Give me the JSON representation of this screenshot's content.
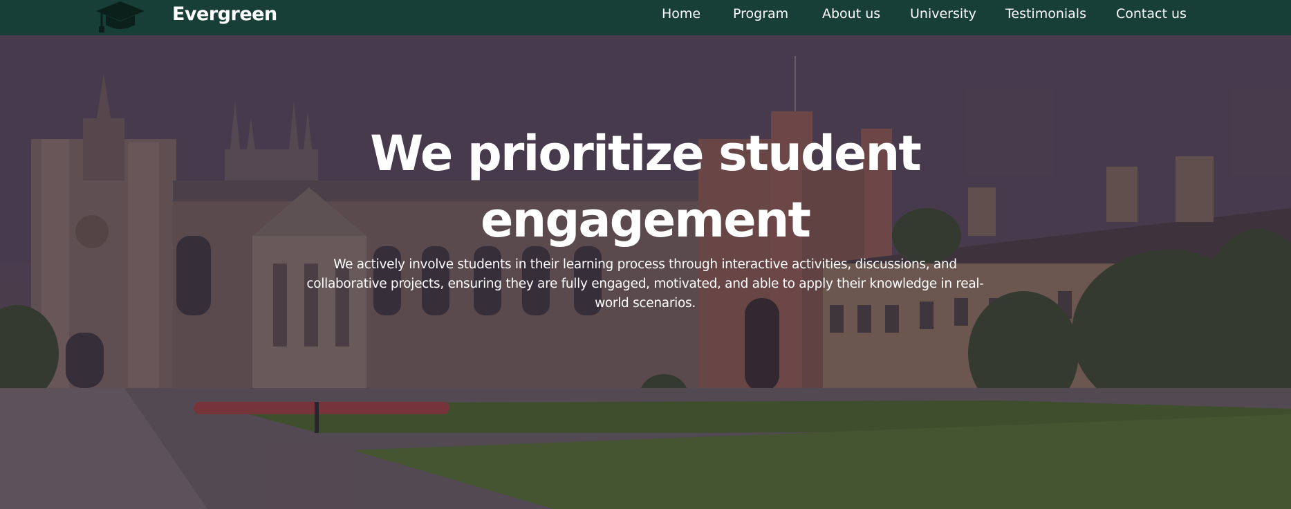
{
  "navbar": {
    "brand": "Evergreen",
    "logo_icon": "graduation-cap-icon",
    "links": [
      {
        "label": "Home"
      },
      {
        "label": "Program"
      },
      {
        "label": "About us"
      },
      {
        "label": "University"
      },
      {
        "label": "Testimonials"
      },
      {
        "label": "Contact us"
      }
    ]
  },
  "hero": {
    "title": "We prioritize student engagement",
    "subtitle": "We actively involve students in their learning process through interactive activities, discussions, and collaborative projects, ensuring they are fully engaged, motivated, and able to apply their knowledge in real-world scenarios.",
    "background_image": "university-courtyard-photo"
  },
  "colors": {
    "navbar_bg": "#173e37",
    "text": "#ffffff",
    "overlay": "#3a2c40"
  }
}
